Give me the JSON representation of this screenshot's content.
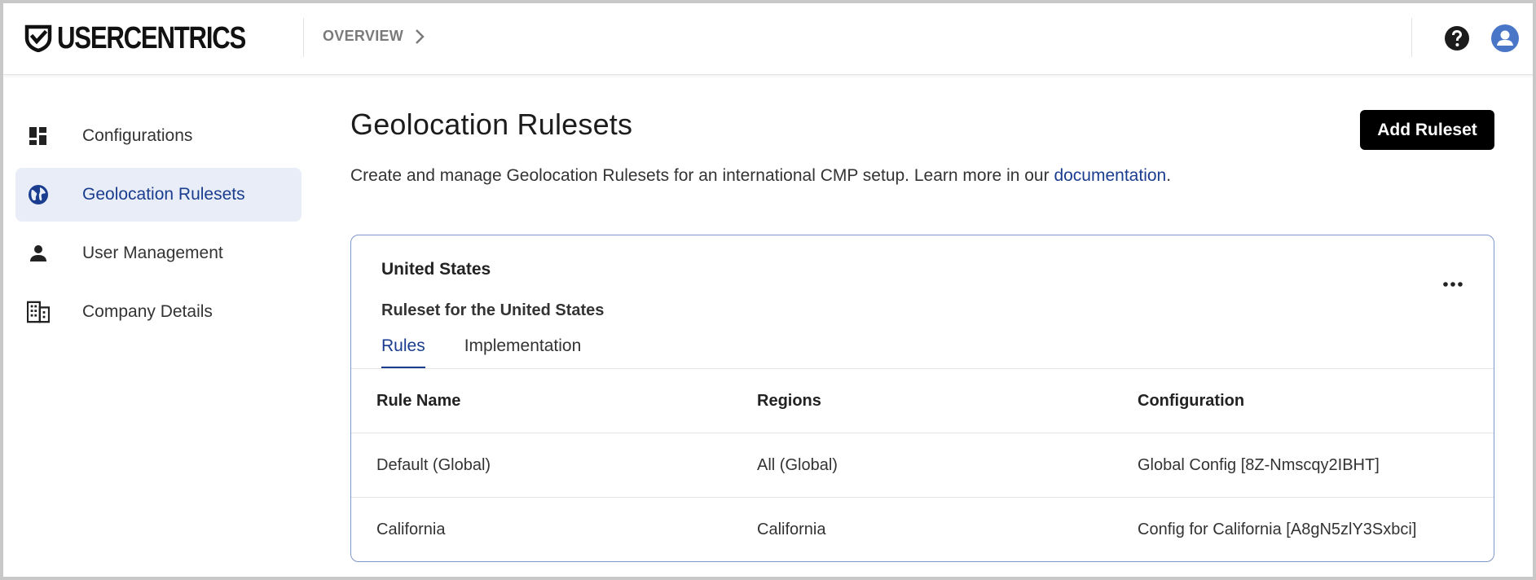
{
  "header": {
    "logo_text": "USERCENTRICS",
    "breadcrumb": "OVERVIEW",
    "help_icon": "help-circle-icon",
    "account_icon": "account-avatar-icon"
  },
  "sidebar": {
    "items": [
      {
        "label": "Configurations",
        "icon": "dashboard-icon",
        "active": false
      },
      {
        "label": "Geolocation Rulesets",
        "icon": "globe-icon",
        "active": true
      },
      {
        "label": "User Management",
        "icon": "person-icon",
        "active": false
      },
      {
        "label": "Company Details",
        "icon": "building-icon",
        "active": false
      }
    ]
  },
  "main": {
    "title": "Geolocation Rulesets",
    "add_button": "Add Ruleset",
    "description": "Create and manage Geolocation Rulesets for an international CMP setup. Learn more in our ",
    "doc_link": "documentation",
    "description_end": "."
  },
  "card": {
    "title": "United States",
    "subtitle": "Ruleset for the United States",
    "tabs": [
      {
        "label": "Rules",
        "active": true
      },
      {
        "label": "Implementation",
        "active": false
      }
    ],
    "table": {
      "headers": [
        "Rule Name",
        "Regions",
        "Configuration"
      ],
      "rows": [
        [
          "Default (Global)",
          "All (Global)",
          "Global Config [8Z-Nmscqy2IBHT]"
        ],
        [
          "California",
          "California",
          "Config for California [A8gN5zlY3Sxbci]"
        ]
      ]
    }
  },
  "colors": {
    "accent": "#1a3d8f",
    "active_bg": "#e8edf7",
    "card_border": "#7f97c9",
    "avatar": "#4a76c7",
    "button_bg": "#000000"
  }
}
